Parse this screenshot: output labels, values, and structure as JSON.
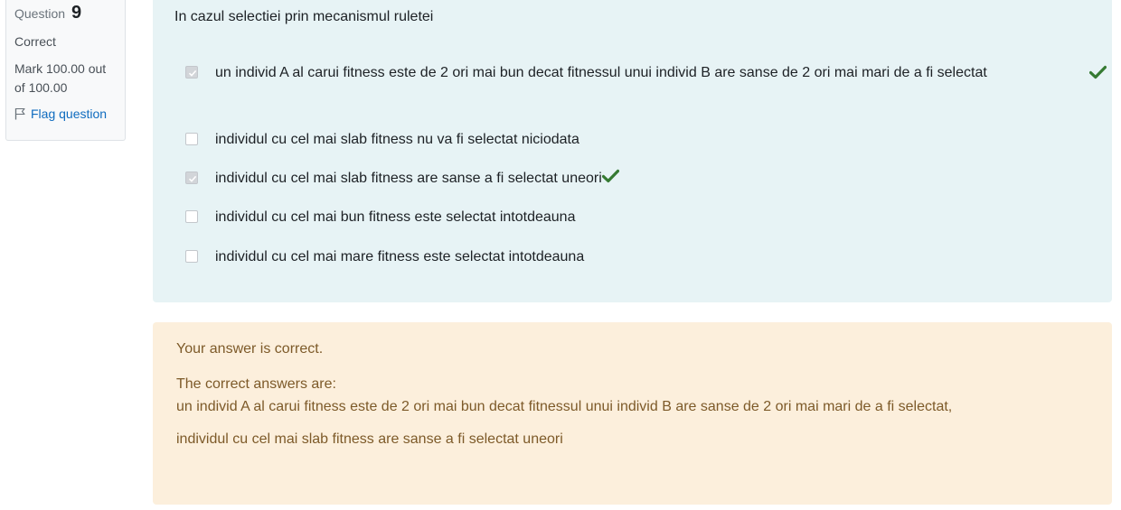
{
  "info": {
    "question_label": "Question",
    "question_number": "9",
    "state": "Correct",
    "grade": "Mark 100.00 out of 100.00",
    "flag_label": "Flag question",
    "flag_icon": "flag-icon"
  },
  "question": {
    "text": "In cazul selectiei prin mecanismul ruletei",
    "options": [
      {
        "label": "un individ A al carui fitness este de 2 ori mai bun decat fitnessul unui individ B are sanse de 2 ori mai mari de a fi selectat",
        "checked": true,
        "correct_mark": true
      },
      {
        "label": "individul cu cel mai slab fitness nu va fi selectat niciodata",
        "checked": false,
        "correct_mark": false
      },
      {
        "label": "individul cu cel mai slab fitness are sanse a fi selectat uneori",
        "checked": true,
        "correct_mark": true
      },
      {
        "label": "individul cu cel mai bun fitness este selectat intotdeauna",
        "checked": false,
        "correct_mark": false
      },
      {
        "label": "individul cu cel mai mare fitness este selectat intotdeauna",
        "checked": false,
        "correct_mark": false
      }
    ]
  },
  "outcome": {
    "feedback": "Your answer is correct.",
    "right_answer_heading": "The correct answers are:",
    "right_answer_1": "un individ A al carui fitness este de 2 ori mai bun decat fitnessul unui individ B are sanse de 2 ori mai mari de a fi selectat,",
    "right_answer_2": "individul cu cel mai slab fitness are sanse a fi selectat uneori"
  },
  "colors": {
    "formulation_bg": "#e7f3f5",
    "outcome_bg": "#fcefdc",
    "outcome_text": "#7d5a29",
    "correct_tick": "#357a32",
    "link": "#0f6cbf"
  }
}
